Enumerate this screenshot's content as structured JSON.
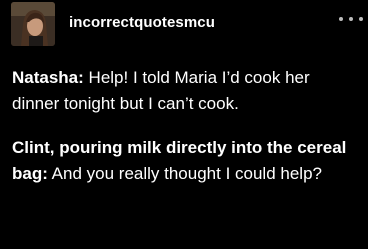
{
  "post": {
    "blog_name": "incorrectquotesmcu",
    "avatar_icon": "blog-avatar-icon",
    "more_icon": "more-options-icon",
    "lines": [
      {
        "speaker": "Natasha:",
        "text": " Help! I told Maria I’d cook her dinner tonight but I can’t cook."
      },
      {
        "speaker": "Clint, pouring milk directly into the cereal bag:",
        "text": " And you really thought I could help?"
      }
    ]
  },
  "colors": {
    "background": "#000000",
    "text": "#ffffff",
    "dots": "#bcbcbc"
  }
}
